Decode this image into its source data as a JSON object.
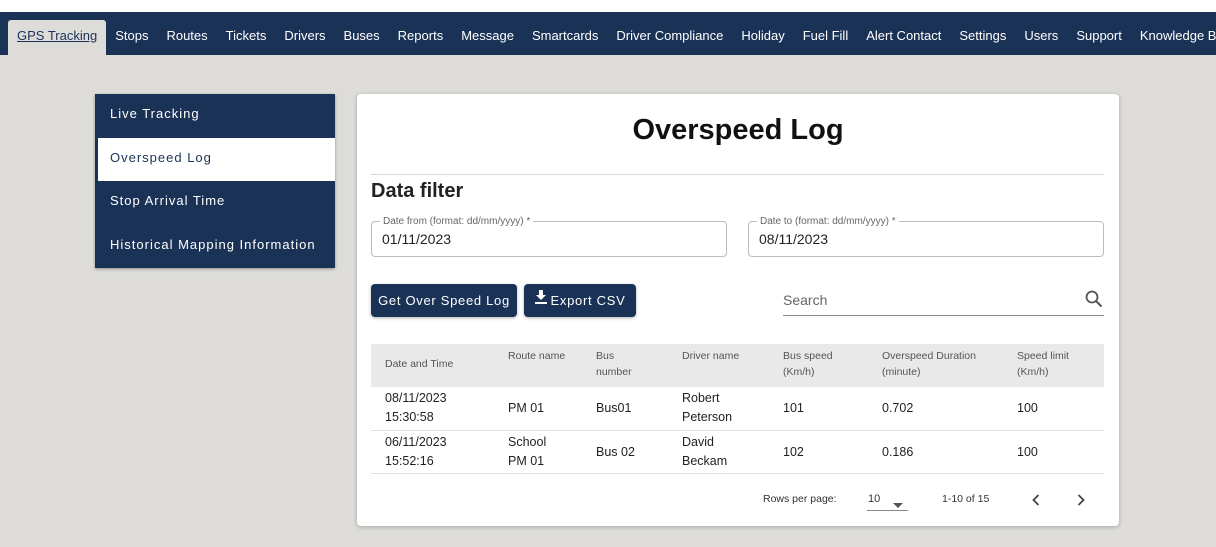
{
  "nav": {
    "items": [
      {
        "label": "GPS Tracking"
      },
      {
        "label": "Stops"
      },
      {
        "label": "Routes"
      },
      {
        "label": "Tickets"
      },
      {
        "label": "Drivers"
      },
      {
        "label": "Buses"
      },
      {
        "label": "Reports"
      },
      {
        "label": "Message"
      },
      {
        "label": "Smartcards"
      },
      {
        "label": "Driver Compliance"
      },
      {
        "label": "Holiday"
      },
      {
        "label": "Fuel Fill"
      },
      {
        "label": "Alert Contact"
      },
      {
        "label": "Settings"
      },
      {
        "label": "Users"
      },
      {
        "label": "Support"
      },
      {
        "label": "Knowledge Base"
      }
    ],
    "active": "GPS Tracking"
  },
  "sidebar": {
    "items": [
      {
        "label": "Live Tracking"
      },
      {
        "label": "Overspeed Log"
      },
      {
        "label": "Stop Arrival Time"
      },
      {
        "label": "Historical Mapping Information"
      }
    ],
    "active": "Overspeed Log"
  },
  "main": {
    "title": "Overspeed Log",
    "filter_heading": "Data filter",
    "date_from": {
      "label": "Date from (format: dd/mm/yyyy) *",
      "value": "01/11/2023"
    },
    "date_to": {
      "label": "Date to (format: dd/mm/yyyy) *",
      "value": "08/11/2023"
    },
    "get_button": "Get Over Speed Log",
    "export_button": "Export CSV",
    "search": {
      "placeholder": "Search",
      "value": ""
    }
  },
  "table": {
    "headers": [
      "Date and Time",
      "Route name",
      "Bus number",
      "Driver name",
      "Bus speed (Km/h)",
      "Overspeed Duration (minute)",
      "Speed limit (Km/h)"
    ],
    "rows": [
      {
        "date": "08/11/2023",
        "time": "15:30:58",
        "route": "PM 01",
        "bus": "Bus01",
        "driver_first": "Robert",
        "driver_last": "Peterson",
        "speed": "101",
        "duration": "0.702",
        "limit": "100"
      },
      {
        "date": "06/11/2023",
        "time": "15:52:16",
        "route_line1": "School",
        "route_line2": "PM 01",
        "bus": "Bus 02",
        "driver_first": "David",
        "driver_last": "Beckam",
        "speed": "102",
        "duration": "0.186",
        "limit": "100"
      }
    ]
  },
  "pagination": {
    "rows_per_page_label": "Rows per page:",
    "rows_per_page_value": "10",
    "range": "1-10 of 15"
  },
  "colors": {
    "primary": "#1b3257",
    "background": "#dddcd8",
    "table_header": "#e9e9e9"
  },
  "icons": {
    "download": "download-icon",
    "search": "search-icon",
    "caret": "caret-down-icon",
    "prev": "chevron-left-icon",
    "next": "chevron-right-icon"
  }
}
